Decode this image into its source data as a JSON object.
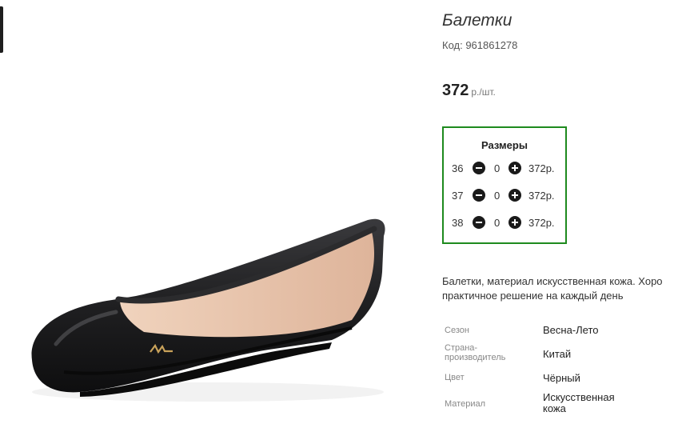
{
  "product": {
    "title": "Балетки",
    "code_label": "Код: 961861278",
    "price": "372",
    "price_unit": "р./шт."
  },
  "sizes": {
    "title": "Размеры",
    "rows": [
      {
        "size": "36",
        "qty": "0",
        "price": "372р."
      },
      {
        "size": "37",
        "qty": "0",
        "price": "372р."
      },
      {
        "size": "38",
        "qty": "0",
        "price": "372р."
      }
    ]
  },
  "description": {
    "line1": "Балетки, материал искусственная кожа. Хоро",
    "line2": "практичное решение на каждый день"
  },
  "specs": [
    {
      "label": "Сезон",
      "value": "Весна-Лето"
    },
    {
      "label": "Страна-производитель",
      "label_line1": "Страна-",
      "label_line2": "производитель",
      "value": "Китай"
    },
    {
      "label": "Цвет",
      "value": "Чёрный"
    },
    {
      "label": "Материал",
      "value": "Искусственная кожа",
      "value_line1": "Искусственная",
      "value_line2": "кожа"
    }
  ],
  "colors": {
    "sizes_border": "#1e8a1e",
    "shoe": "#1c1c1e",
    "lining": "#e8c6ad"
  }
}
